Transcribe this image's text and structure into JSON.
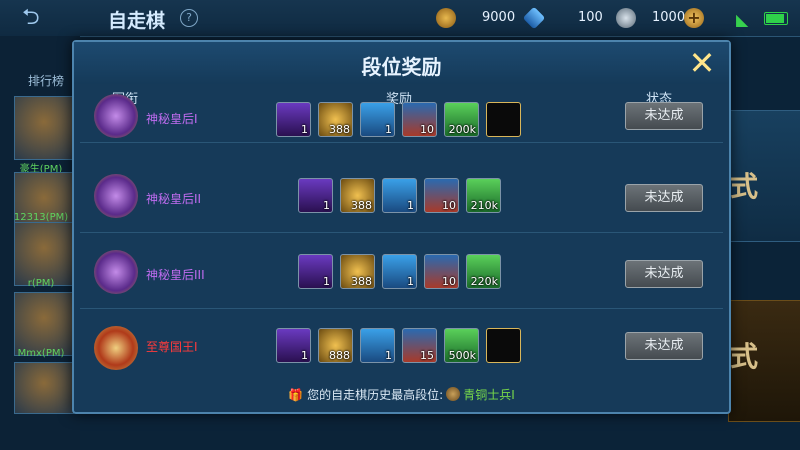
{
  "topbar": {
    "back_icon": "back-arrow-icon",
    "title": "自走棋",
    "help": "?",
    "currencies": [
      {
        "icon": "gold-coin-icon",
        "value": "9000",
        "color": "#c9962f"
      },
      {
        "icon": "diamond-icon",
        "value": "100",
        "color": "#3a8fe0"
      },
      {
        "icon": "silver-coupon-icon",
        "value": "1000",
        "color": "#9fb0bf"
      }
    ],
    "add_icon": "plus-icon"
  },
  "background": {
    "leaderboard_label": "排行榜",
    "players": [
      {
        "rank": "1",
        "name": "豪生(PM)"
      },
      {
        "rank": "2",
        "name": "12313(PM)"
      },
      {
        "rank": "3",
        "name": "r(PM)"
      },
      {
        "rank": "",
        "name": "Mmx(PM)"
      }
    ],
    "right_text_1": "式",
    "right_text_2": "式"
  },
  "modal": {
    "title": "段位奖励",
    "columns": {
      "rank": "军衔",
      "reward": "奖励",
      "status": "状态"
    },
    "rows": [
      {
        "rank_name": "神秘皇后I",
        "rank_color": "#c06cf0",
        "items": [
          {
            "icon": "purple-card-icon",
            "qty": "1"
          },
          {
            "icon": "gold-coins-icon",
            "qty": "388"
          },
          {
            "icon": "treasure-chest-icon",
            "qty": "1"
          },
          {
            "icon": "box-item-icon",
            "qty": "10"
          },
          {
            "icon": "green-ticket-icon",
            "qty": "200k"
          },
          {
            "icon": "dark-frame-icon",
            "qty": ""
          }
        ],
        "status": "未达成"
      },
      {
        "rank_name": "神秘皇后II",
        "rank_color": "#c06cf0",
        "items": [
          {
            "icon": "purple-card-icon",
            "qty": "1"
          },
          {
            "icon": "gold-coins-icon",
            "qty": "388"
          },
          {
            "icon": "treasure-chest-icon",
            "qty": "1"
          },
          {
            "icon": "box-item-icon",
            "qty": "10"
          },
          {
            "icon": "green-ticket-icon",
            "qty": "210k"
          }
        ],
        "status": "未达成"
      },
      {
        "rank_name": "神秘皇后III",
        "rank_color": "#c06cf0",
        "items": [
          {
            "icon": "purple-card-icon",
            "qty": "1"
          },
          {
            "icon": "gold-coins-icon",
            "qty": "388"
          },
          {
            "icon": "treasure-chest-icon",
            "qty": "1"
          },
          {
            "icon": "box-item-icon",
            "qty": "10"
          },
          {
            "icon": "green-ticket-icon",
            "qty": "220k"
          }
        ],
        "status": "未达成"
      },
      {
        "rank_name": "至尊国王I",
        "rank_color": "#ff3b3b",
        "items": [
          {
            "icon": "purple-card-icon",
            "qty": "1"
          },
          {
            "icon": "gold-coins-icon",
            "qty": "888"
          },
          {
            "icon": "treasure-chest-icon",
            "qty": "1"
          },
          {
            "icon": "box-item-icon",
            "qty": "15"
          },
          {
            "icon": "green-ticket-icon",
            "qty": "500k"
          },
          {
            "icon": "dark-frame-icon",
            "qty": ""
          }
        ],
        "status": "未达成"
      }
    ],
    "footer": {
      "text": "您的自走棋历史最高段位:",
      "rank": "青铜士兵I"
    }
  }
}
